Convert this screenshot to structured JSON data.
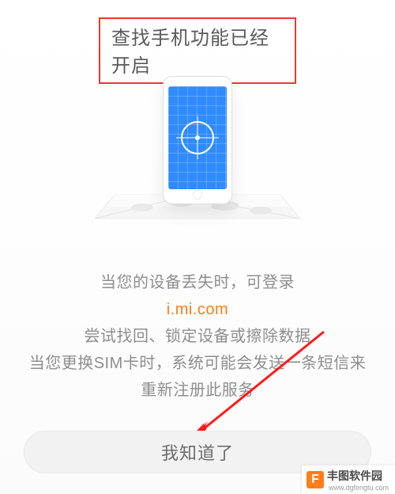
{
  "title": "查找手机功能已经开启",
  "info": {
    "line1": "当您的设备丢失时，可登录",
    "url": "i.mi.com",
    "line2": "尝试找回、锁定设备或擦除数据",
    "line3": "当您更换SIM卡时，系统可能会发送一条短信来重新注册此服务"
  },
  "button": {
    "ok": "我知道了"
  },
  "watermark": {
    "logo_letter": "F",
    "name": "丰图软件园",
    "site": "www.dgfengtu.com"
  },
  "colors": {
    "accent": "#ff7d1a",
    "highlight_border": "#e53935",
    "arrow": "#ff1a1a"
  }
}
